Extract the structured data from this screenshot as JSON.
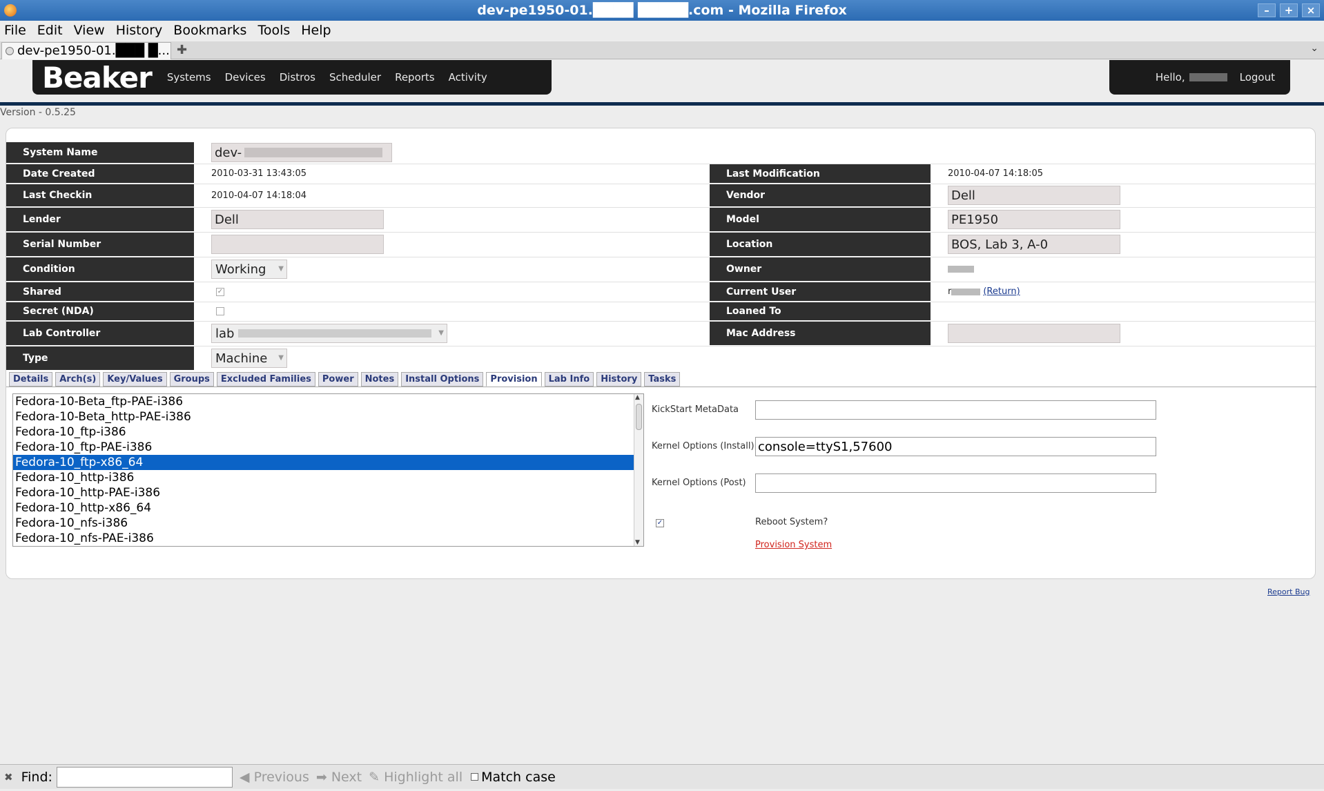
{
  "window": {
    "title": "dev-pe1950-01.████ █████.com - Mozilla Firefox",
    "buttons": [
      "–",
      "+",
      "×"
    ]
  },
  "menubar": [
    "File",
    "Edit",
    "View",
    "History",
    "Bookmarks",
    "Tools",
    "Help"
  ],
  "tab": {
    "label": "dev-pe1950-01.███ █...",
    "new_tab": "✚",
    "menu": "⌄"
  },
  "beaker": {
    "logo": "Beaker",
    "nav": [
      "Systems",
      "Devices",
      "Distros",
      "Scheduler",
      "Reports",
      "Activity"
    ],
    "hello": "Hello,",
    "logout": "Logout",
    "version": "Version - 0.5.25"
  },
  "system": {
    "system_name_label": "System Name",
    "system_name_value": "dev-",
    "date_created_label": "Date Created",
    "date_created_value": "2010-03-31 13:43:05",
    "last_modification_label": "Last Modification",
    "last_modification_value": "2010-04-07 14:18:05",
    "last_checkin_label": "Last Checkin",
    "last_checkin_value": "2010-04-07 14:18:04",
    "vendor_label": "Vendor",
    "vendor_value": "Dell",
    "lender_label": "Lender",
    "lender_value": "Dell",
    "model_label": "Model",
    "model_value": "PE1950",
    "serial_label": "Serial Number",
    "serial_value": "",
    "location_label": "Location",
    "location_value": "BOS, Lab 3, A-0",
    "condition_label": "Condition",
    "condition_value": "Working",
    "owner_label": "Owner",
    "shared_label": "Shared",
    "current_user_label": "Current User",
    "current_user_prefix": "r",
    "return_link": "(Return)",
    "secret_label": "Secret (NDA)",
    "loaned_label": "Loaned To",
    "lab_controller_label": "Lab Controller",
    "lab_controller_value": "lab",
    "mac_label": "Mac Address",
    "type_label": "Type",
    "type_value": "Machine"
  },
  "tabs": [
    "Details",
    "Arch(s)",
    "Key/Values",
    "Groups",
    "Excluded Families",
    "Power",
    "Notes",
    "Install Options",
    "Provision",
    "Lab Info",
    "History",
    "Tasks"
  ],
  "active_tab": "Provision",
  "provision": {
    "distros": [
      "Fedora-10-Beta_ftp-PAE-i386",
      "Fedora-10-Beta_http-PAE-i386",
      "Fedora-10_ftp-i386",
      "Fedora-10_ftp-PAE-i386",
      "Fedora-10_ftp-x86_64",
      "Fedora-10_http-i386",
      "Fedora-10_http-PAE-i386",
      "Fedora-10_http-x86_64",
      "Fedora-10_nfs-i386",
      "Fedora-10_nfs-PAE-i386"
    ],
    "selected_distro": "Fedora-10_ftp-x86_64",
    "ks_meta_label": "KickStart MetaData",
    "ks_meta_value": "",
    "kernel_install_label": "Kernel Options (Install)",
    "kernel_install_value": "console=ttyS1,57600",
    "kernel_post_label": "Kernel Options (Post)",
    "kernel_post_value": "",
    "reboot_label": "Reboot System?",
    "reboot_checked": true,
    "provision_link": "Provision System"
  },
  "report_bug": "Report Bug",
  "findbar": {
    "close": "✖",
    "label": "Find:",
    "value": "",
    "previous": "Previous",
    "next": "Next",
    "highlight": "Highlight all",
    "match_case": "Match case"
  },
  "colors": {
    "selection": "#0b63c6",
    "label_bg": "#2e2e2e",
    "provision_link": "#d0231b"
  }
}
